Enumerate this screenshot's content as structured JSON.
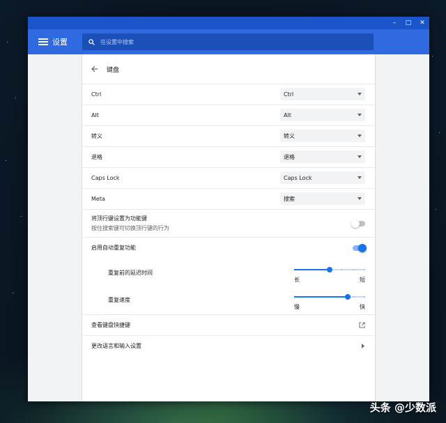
{
  "window": {
    "controls": {
      "minimize": "–",
      "maximize": "□",
      "close": "✕"
    }
  },
  "header": {
    "title": "设置",
    "search_placeholder": "在设置中搜索"
  },
  "page": {
    "title": "键盘"
  },
  "key_remaps": [
    {
      "label": "Ctrl",
      "value": "Ctrl"
    },
    {
      "label": "Alt",
      "value": "Alt"
    },
    {
      "label": "转义",
      "value": "转义"
    },
    {
      "label": "退格",
      "value": "退格"
    },
    {
      "label": "Caps Lock",
      "value": "Caps Lock"
    },
    {
      "label": "Meta",
      "value": "搜索"
    }
  ],
  "top_row": {
    "label": "将顶行键设置为功能键",
    "sublabel": "按住搜索键可切换顶行键的行为",
    "enabled": false
  },
  "auto_repeat": {
    "label": "启用自动重复功能",
    "enabled": true
  },
  "delay": {
    "label": "重复前的延迟时间",
    "min_label": "长",
    "max_label": "短",
    "level": 0.5
  },
  "rate": {
    "label": "重复速度",
    "min_label": "慢",
    "max_label": "快",
    "level": 0.75
  },
  "links": {
    "shortcuts": "查看键盘快捷键",
    "language": "更改语言和输入设置"
  },
  "watermark": "头条 @少数派",
  "colors": {
    "accent": "#1a73e8",
    "header": "#2f6ae0",
    "titlebar": "#1a56c9"
  },
  "icons": {
    "menu": "hamburger-icon",
    "search": "search-icon",
    "back": "arrow-back-icon",
    "external": "open-in-new-icon",
    "chevron": "chevron-right-icon"
  }
}
